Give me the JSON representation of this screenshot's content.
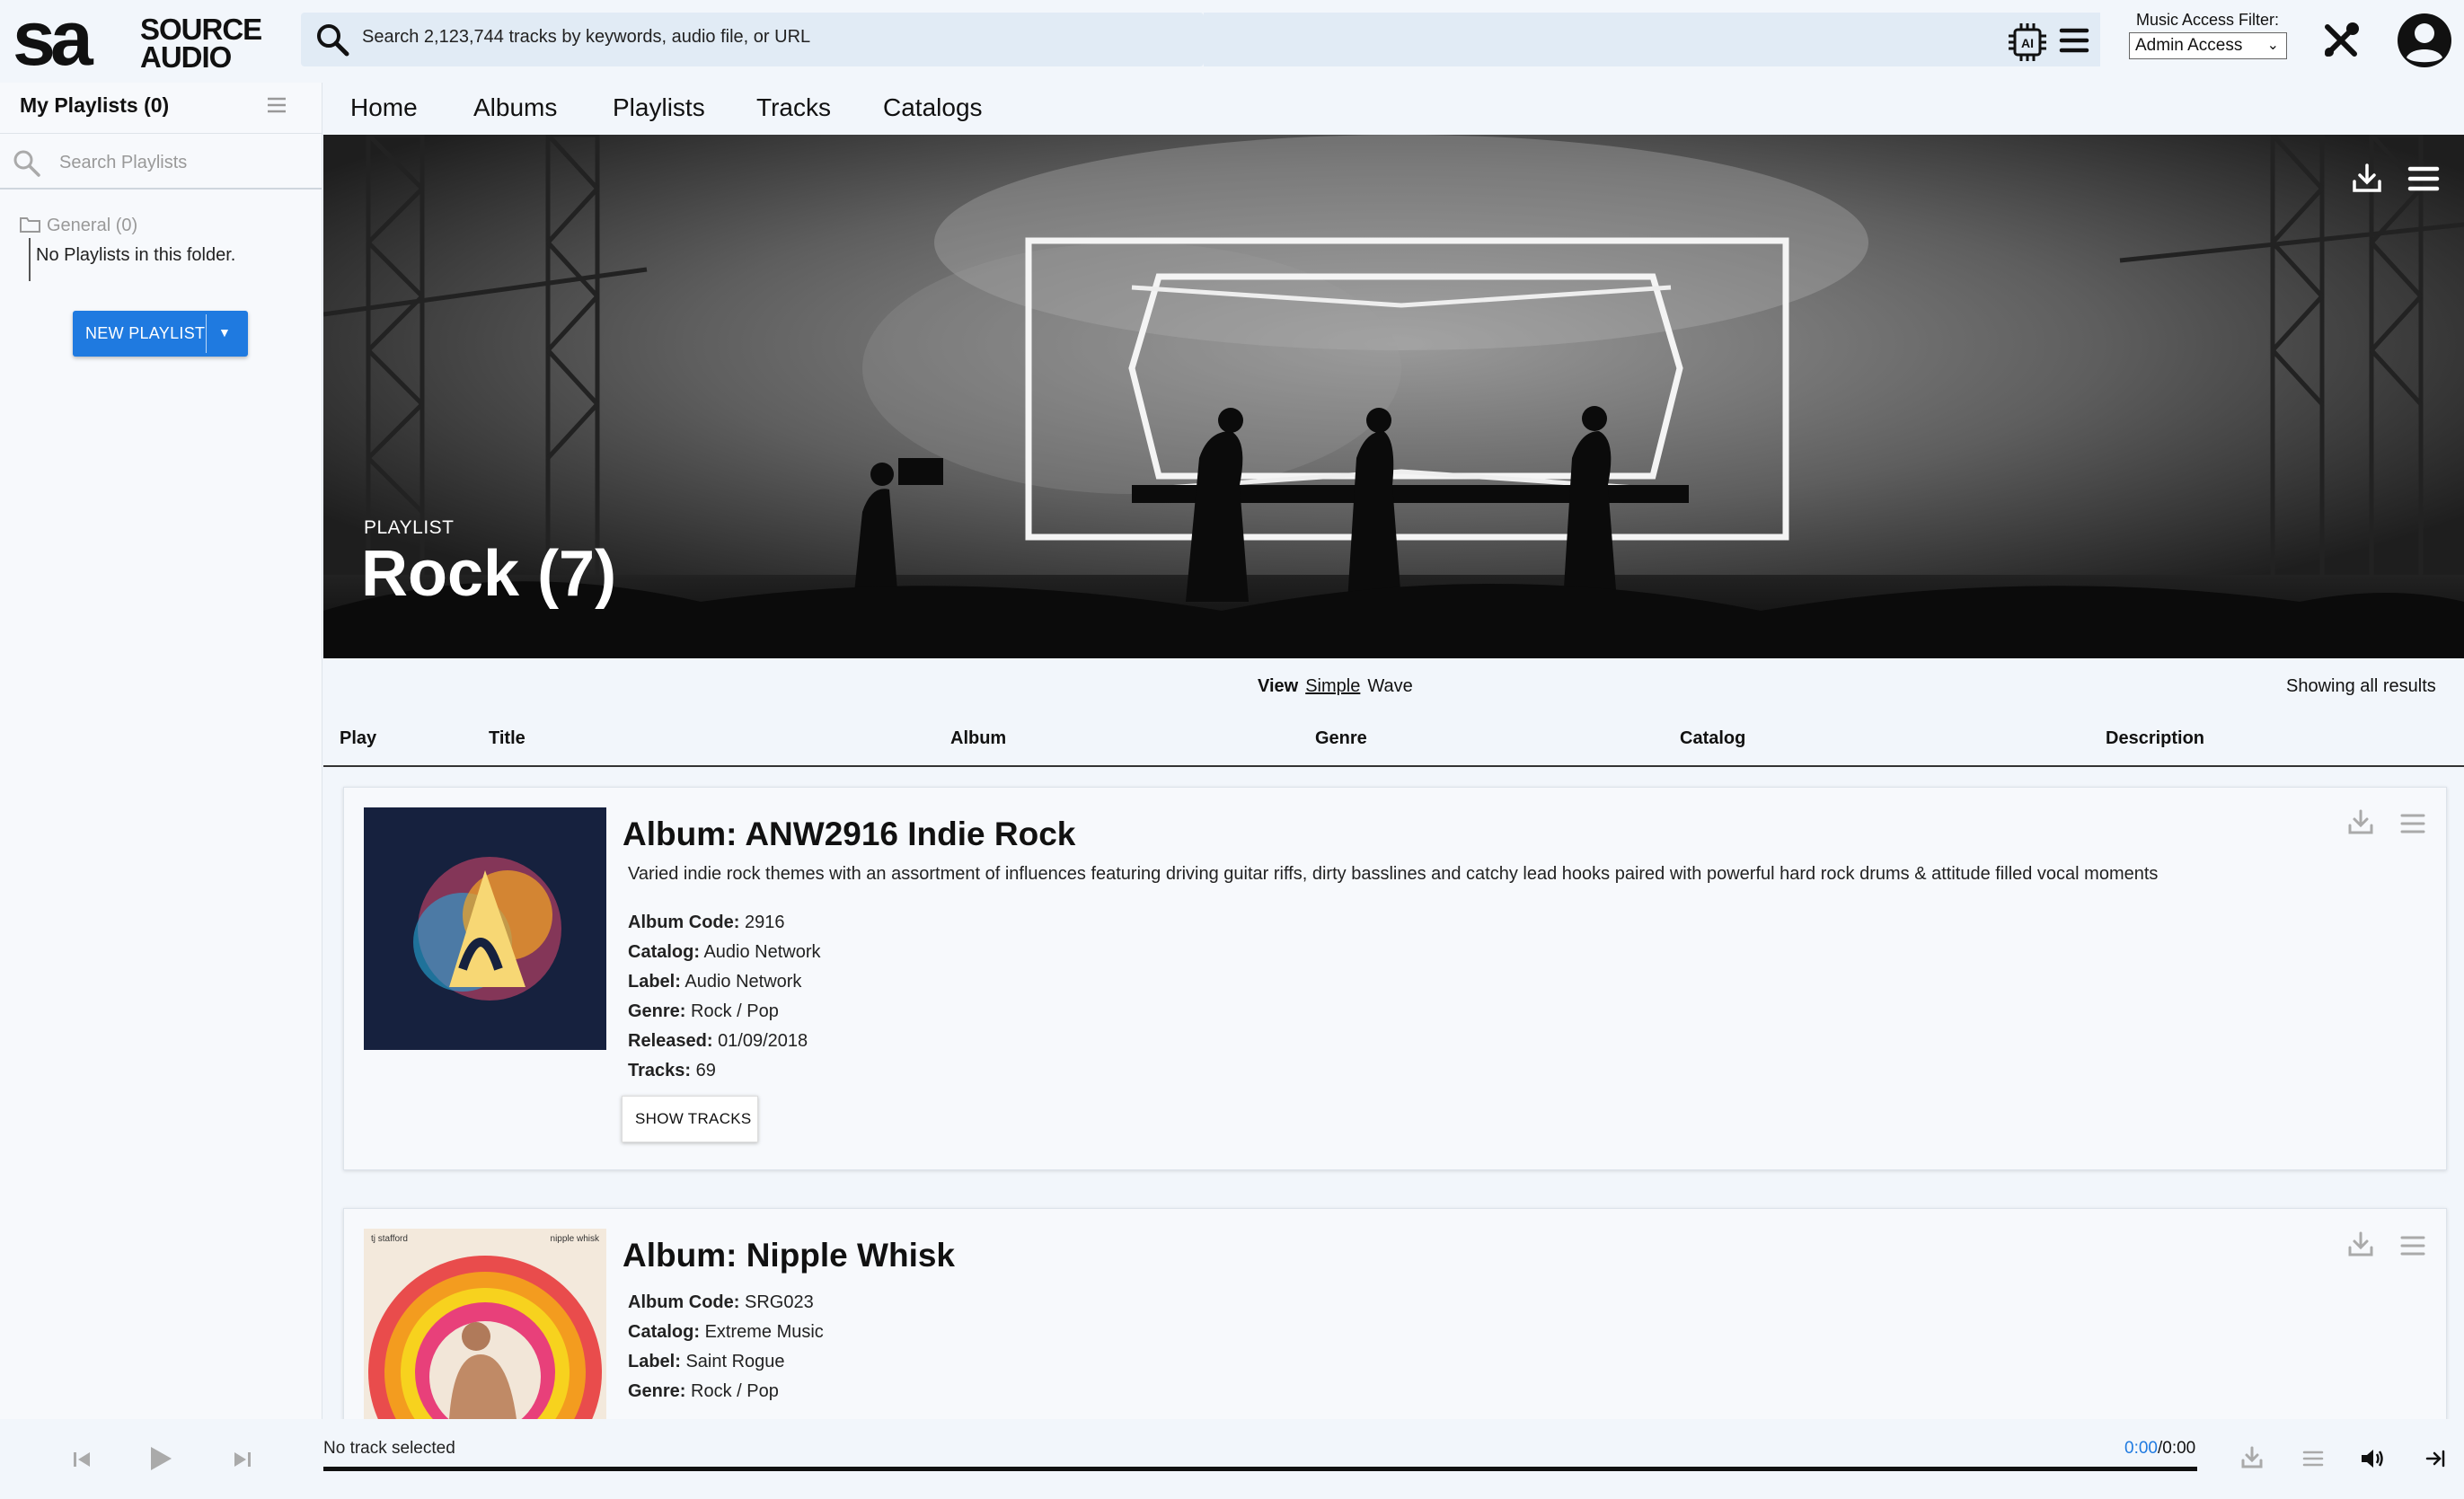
{
  "brand": {
    "logo_mark": "sa",
    "logo_line1": "SOURCE",
    "logo_line2": "AUDIO"
  },
  "search": {
    "placeholder": "Search 2,123,744 tracks by keywords, audio file, or URL"
  },
  "filter": {
    "label": "Music Access Filter:",
    "value": "Admin Access"
  },
  "sidebar": {
    "title": "My Playlists (0)",
    "search_placeholder": "Search Playlists",
    "folder": "General (0)",
    "empty": "No Playlists in this folder.",
    "new_playlist": "NEW PLAYLIST"
  },
  "nav": {
    "items": [
      "Home",
      "Albums",
      "Playlists",
      "Tracks",
      "Catalogs"
    ]
  },
  "hero": {
    "kicker": "PLAYLIST",
    "title": "Rock (7)"
  },
  "view": {
    "label": "View",
    "simple": "Simple",
    "wave": "Wave",
    "showing": "Showing all results"
  },
  "columns": [
    "Play",
    "Title",
    "Album",
    "Genre",
    "Catalog",
    "Description"
  ],
  "albums": [
    {
      "title": "Album: ANW2916 Indie Rock",
      "description": "Varied indie rock themes with an assortment of influences featuring driving guitar riffs, dirty basslines and catchy lead hooks paired with powerful hard rock drums & attitude filled vocal moments",
      "meta": [
        {
          "k": "Album Code:",
          "v": "2916"
        },
        {
          "k": "Catalog:",
          "v": "Audio Network"
        },
        {
          "k": "Label:",
          "v": "Audio Network"
        },
        {
          "k": "Genre:",
          "v": "Rock / Pop"
        },
        {
          "k": "Released:",
          "v": "01/09/2018"
        },
        {
          "k": "Tracks:",
          "v": "69"
        }
      ],
      "show_tracks": "SHOW TRACKS"
    },
    {
      "title": "Album: Nipple Whisk",
      "cover_text_left": "tj stafford",
      "cover_text_right": "nipple whisk",
      "meta": [
        {
          "k": "Album Code:",
          "v": "SRG023"
        },
        {
          "k": "Catalog:",
          "v": "Extreme Music"
        },
        {
          "k": "Label:",
          "v": "Saint Rogue"
        },
        {
          "k": "Genre:",
          "v": "Rock / Pop"
        }
      ]
    }
  ],
  "player": {
    "status": "No track selected",
    "time_current": "0:00",
    "time_total": "/0:00"
  },
  "colors": {
    "accent": "#1f7ae0",
    "background": "#f2f6fb",
    "search_bg": "#e1ebf5"
  },
  "icons": [
    "search-icon",
    "ai-icon",
    "menu-icon",
    "tools-icon",
    "user-icon",
    "download-icon",
    "folder-icon",
    "play-icon",
    "prev-icon",
    "next-icon",
    "volume-icon",
    "collapse-icon"
  ]
}
